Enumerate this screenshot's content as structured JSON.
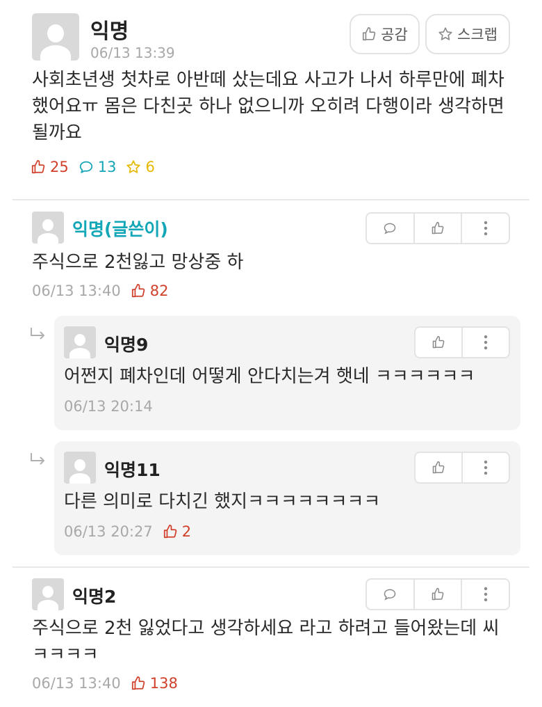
{
  "post": {
    "author": "익명",
    "time": "06/13 13:39",
    "like_button": "공감",
    "scrap_button": "스크랩",
    "body_lines": [
      "사회초년생 첫차로 아반떼 샀는데요 사고가 나서 하루만에 폐차",
      "했어요ㅠ 몸은 다친곳 하나 없으니까 오히려 다행이라 생각하면",
      "될까요"
    ],
    "likes": "25",
    "comments": "13",
    "scraps": "6"
  },
  "comments": [
    {
      "author": "익명(글쓴이)",
      "text": "주식으로 2천잃고 망상중 하",
      "time": "06/13 13:40",
      "likes": "82"
    },
    {
      "author": "익명2",
      "text_lines": [
        "주식으로 2천 잃었다고 생각하세요 라고 하려고 들어왔는데 씨",
        "ㅋㅋㅋㅋ"
      ],
      "time": "06/13 13:40",
      "likes": "138"
    }
  ],
  "replies": [
    {
      "author": "익명9",
      "text": "어쩐지 폐차인데 어떻게 안다치는겨 햇네 ㅋㅋㅋㅋㅋㅋ",
      "time": "06/13 20:14"
    },
    {
      "author": "익명11",
      "text": "다른 의미로 다치긴 했지ㅋㅋㅋㅋㅋㅋㅋㅋ",
      "time": "06/13 20:27",
      "likes": "2"
    }
  ],
  "colors": {
    "like_red": "#d0402a",
    "comment_teal": "#12a6b6",
    "scrap_yellow": "#e8b800",
    "op_nick_teal": "#12a6b6"
  }
}
